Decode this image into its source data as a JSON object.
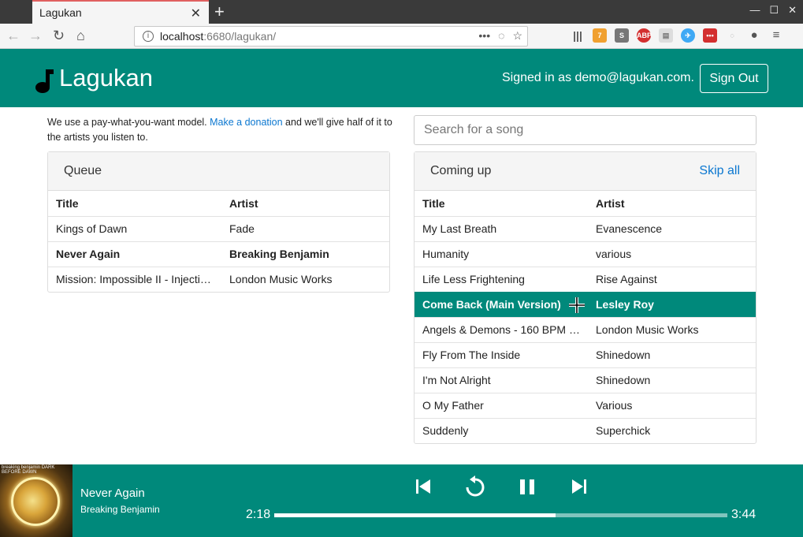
{
  "browser": {
    "tab_title": "Lagukan",
    "url_host": "localhost",
    "url_rest": ":6680/lagukan/",
    "ext_badge": "7"
  },
  "app": {
    "title": "Lagukan",
    "signed_in": "Signed in as demo@lagukan.com.",
    "sign_out": "Sign Out",
    "accent": "#00897b"
  },
  "donate": {
    "before": "We use a pay-what-you-want model. ",
    "link": "Make a donation",
    "after": " and we'll give half of it to the artists you listen to."
  },
  "search": {
    "placeholder": "Search for a song"
  },
  "queue": {
    "title": "Queue",
    "headers": [
      "Title",
      "Artist"
    ],
    "rows": [
      {
        "title": "Kings of Dawn",
        "artist": "Fade"
      },
      {
        "title": "Never Again",
        "artist": "Breaking Benjamin"
      },
      {
        "title": "Mission: Impossible II - Injectio...",
        "artist": "London Music Works"
      }
    ]
  },
  "coming_up": {
    "title": "Coming up",
    "action": "Skip all",
    "headers": [
      "Title",
      "Artist"
    ],
    "rows": [
      {
        "title": "My Last Breath",
        "artist": "Evanescence"
      },
      {
        "title": "Humanity",
        "artist": "various"
      },
      {
        "title": "Life Less Frightening",
        "artist": "Rise Against"
      },
      {
        "title": "Come Back (Main Version)",
        "artist": "Lesley Roy"
      },
      {
        "title": "Angels & Demons - 160 BPM (...",
        "artist": "London Music Works"
      },
      {
        "title": "Fly From The Inside",
        "artist": "Shinedown"
      },
      {
        "title": "I'm Not Alright",
        "artist": "Shinedown"
      },
      {
        "title": "O My Father",
        "artist": "Various"
      },
      {
        "title": "Suddenly",
        "artist": "Superchick"
      }
    ]
  },
  "player": {
    "album_text": "breaking benjamin     DARK BEFORE DAWN",
    "title": "Never Again",
    "artist": "Breaking Benjamin",
    "elapsed": "2:18",
    "duration": "3:44",
    "progress": 0.62
  }
}
